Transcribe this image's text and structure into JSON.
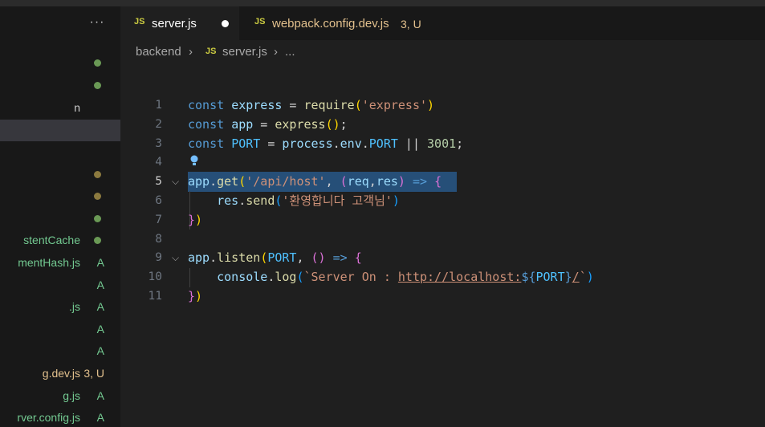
{
  "sidebar": {
    "more_label": "···",
    "items": [
      {
        "name": "",
        "dot": "#6a9955",
        "badge": ""
      },
      {
        "name": "",
        "dot": "#6a9955",
        "badge": ""
      },
      {
        "name": "n",
        "dot": "",
        "badge": ""
      },
      {
        "name": "",
        "dot": "",
        "badge": "",
        "selected": true
      },
      {
        "name": "",
        "dot": "#8c7a3f",
        "badge": ""
      },
      {
        "name": "",
        "dot": "#8c7a3f",
        "badge": ""
      },
      {
        "name": "",
        "dot": "#6a9955",
        "badge": ""
      },
      {
        "name": "stentCache",
        "dot": "#6a9955",
        "badge": ""
      },
      {
        "name": "mentHash.js",
        "dot": "",
        "badge": "A"
      },
      {
        "name": "",
        "dot": "",
        "badge": "A"
      },
      {
        "name": ".js",
        "dot": "",
        "badge": "A"
      },
      {
        "name": "",
        "dot": "",
        "badge": "A"
      },
      {
        "name": "",
        "dot": "",
        "badge": "A"
      },
      {
        "name": "g.dev.js",
        "dot": "",
        "badge": "3, U",
        "modified": true
      },
      {
        "name": "g.js",
        "dot": "",
        "badge": "A"
      },
      {
        "name": "rver.config.js",
        "dot": "",
        "badge": "A"
      }
    ]
  },
  "tabs": [
    {
      "icon": "JS",
      "label": "server.js",
      "active": true,
      "dirty": true
    },
    {
      "icon": "JS",
      "label": "webpack.config.dev.js",
      "status": "3, U",
      "active": false
    }
  ],
  "breadcrumb": {
    "folder": "backend",
    "sep": "›",
    "icon": "JS",
    "file": "server.js",
    "tail": "..."
  },
  "editor": {
    "line_numbers": [
      "1",
      "2",
      "3",
      "4",
      "5",
      "6",
      "7",
      "8",
      "9",
      "10",
      "11"
    ],
    "active_line": "5",
    "lines": [
      [
        [
          "k",
          "const"
        ],
        [
          "p",
          " "
        ],
        [
          "v",
          "express"
        ],
        [
          "p",
          " = "
        ],
        [
          "f",
          "require"
        ],
        [
          "y",
          "("
        ],
        [
          "s",
          "'express'"
        ],
        [
          "y",
          ")"
        ]
      ],
      [
        [
          "k",
          "const"
        ],
        [
          "p",
          " "
        ],
        [
          "v",
          "app"
        ],
        [
          "p",
          " = "
        ],
        [
          "f",
          "express"
        ],
        [
          "y",
          "()"
        ],
        [
          "p",
          ";"
        ]
      ],
      [
        [
          "k",
          "const"
        ],
        [
          "p",
          " "
        ],
        [
          "c",
          "PORT"
        ],
        [
          "p",
          " = "
        ],
        [
          "v",
          "process"
        ],
        [
          "p",
          "."
        ],
        [
          "v",
          "env"
        ],
        [
          "p",
          "."
        ],
        [
          "c",
          "PORT"
        ],
        [
          "p",
          " || "
        ],
        [
          "n",
          "3001"
        ],
        [
          "p",
          ";"
        ]
      ],
      [],
      [
        [
          "v",
          "app"
        ],
        [
          "p",
          "."
        ],
        [
          "f",
          "get"
        ],
        [
          "y",
          "("
        ],
        [
          "s",
          "'/api/host'"
        ],
        [
          "p",
          ", "
        ],
        [
          "m",
          "("
        ],
        [
          "v",
          "req"
        ],
        [
          "p",
          ","
        ],
        [
          "v",
          "res"
        ],
        [
          "m",
          ")"
        ],
        [
          "p",
          " "
        ],
        [
          "k",
          "=>"
        ],
        [
          "p",
          " "
        ],
        [
          "m",
          "{"
        ]
      ],
      [
        [
          "p",
          "    "
        ],
        [
          "v",
          "res"
        ],
        [
          "p",
          "."
        ],
        [
          "f",
          "send"
        ],
        [
          "b2",
          "("
        ],
        [
          "s",
          "'환영합니다 고객님'"
        ],
        [
          "b2",
          ")"
        ]
      ],
      [
        [
          "m",
          "}"
        ],
        [
          "y",
          ")"
        ]
      ],
      [],
      [
        [
          "v",
          "app"
        ],
        [
          "p",
          "."
        ],
        [
          "f",
          "listen"
        ],
        [
          "y",
          "("
        ],
        [
          "c",
          "PORT"
        ],
        [
          "p",
          ", "
        ],
        [
          "m",
          "()"
        ],
        [
          "p",
          " "
        ],
        [
          "k",
          "=>"
        ],
        [
          "p",
          " "
        ],
        [
          "m",
          "{"
        ]
      ],
      [
        [
          "p",
          "    "
        ],
        [
          "v",
          "console"
        ],
        [
          "p",
          "."
        ],
        [
          "f",
          "log"
        ],
        [
          "b2",
          "("
        ],
        [
          "s",
          "`Server On : "
        ],
        [
          "u",
          "http://localhost:"
        ],
        [
          "k",
          "${"
        ],
        [
          "c",
          "PORT"
        ],
        [
          "k",
          "}"
        ],
        [
          "u",
          "/"
        ],
        [
          "s",
          "`"
        ],
        [
          "b2",
          ")"
        ]
      ],
      [
        [
          "m",
          "}"
        ],
        [
          "y",
          ")"
        ]
      ]
    ]
  }
}
